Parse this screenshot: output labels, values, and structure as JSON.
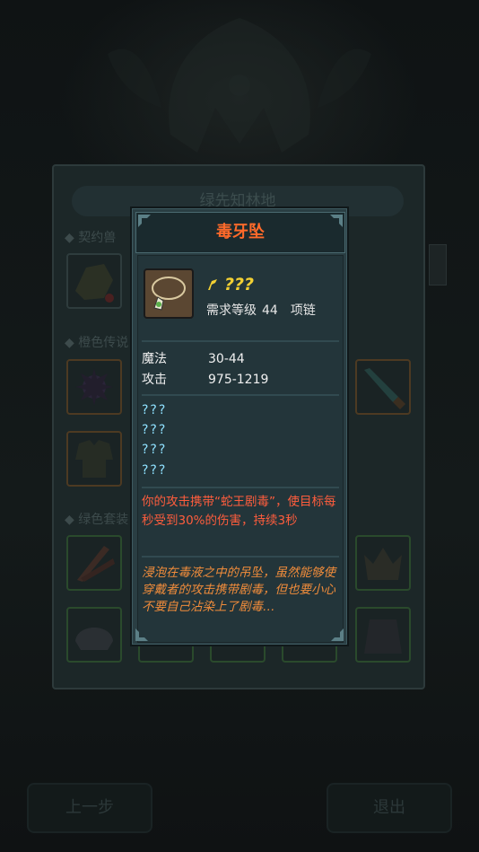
{
  "background": {
    "parent_title": "绿先知林地",
    "sections": [
      "契约兽",
      "橙色传说",
      "绿色套装"
    ],
    "buttons": {
      "back": "上一步",
      "exit": "退出"
    }
  },
  "tooltip": {
    "title": "毒牙坠",
    "rarity": "???",
    "required_level_label": "需求等级",
    "required_level": "44",
    "item_type": "项链",
    "stats": [
      {
        "label": "魔法",
        "value": "30-44"
      },
      {
        "label": "攻击",
        "value": "975-1219"
      }
    ],
    "hidden_attributes": [
      "???",
      "???",
      "???",
      "???"
    ],
    "effect": "你的攻击携带“蛇王剧毒”，使目标每秒受到30%的伤害，持续3秒",
    "lore": "浸泡在毒液之中的吊坠，虽然能够使穿戴者的攻击携带剧毒，但也要小心不要自己沾染上了剧毒…"
  },
  "colors": {
    "title": "#ff6a2a",
    "rarity": "#f2d033",
    "hidden": "#8fe1ff",
    "effect": "#ff5d3d",
    "lore": "#f08c3b"
  },
  "icons": {
    "item": "necklace-icon",
    "rarity": "mystery-icon"
  }
}
